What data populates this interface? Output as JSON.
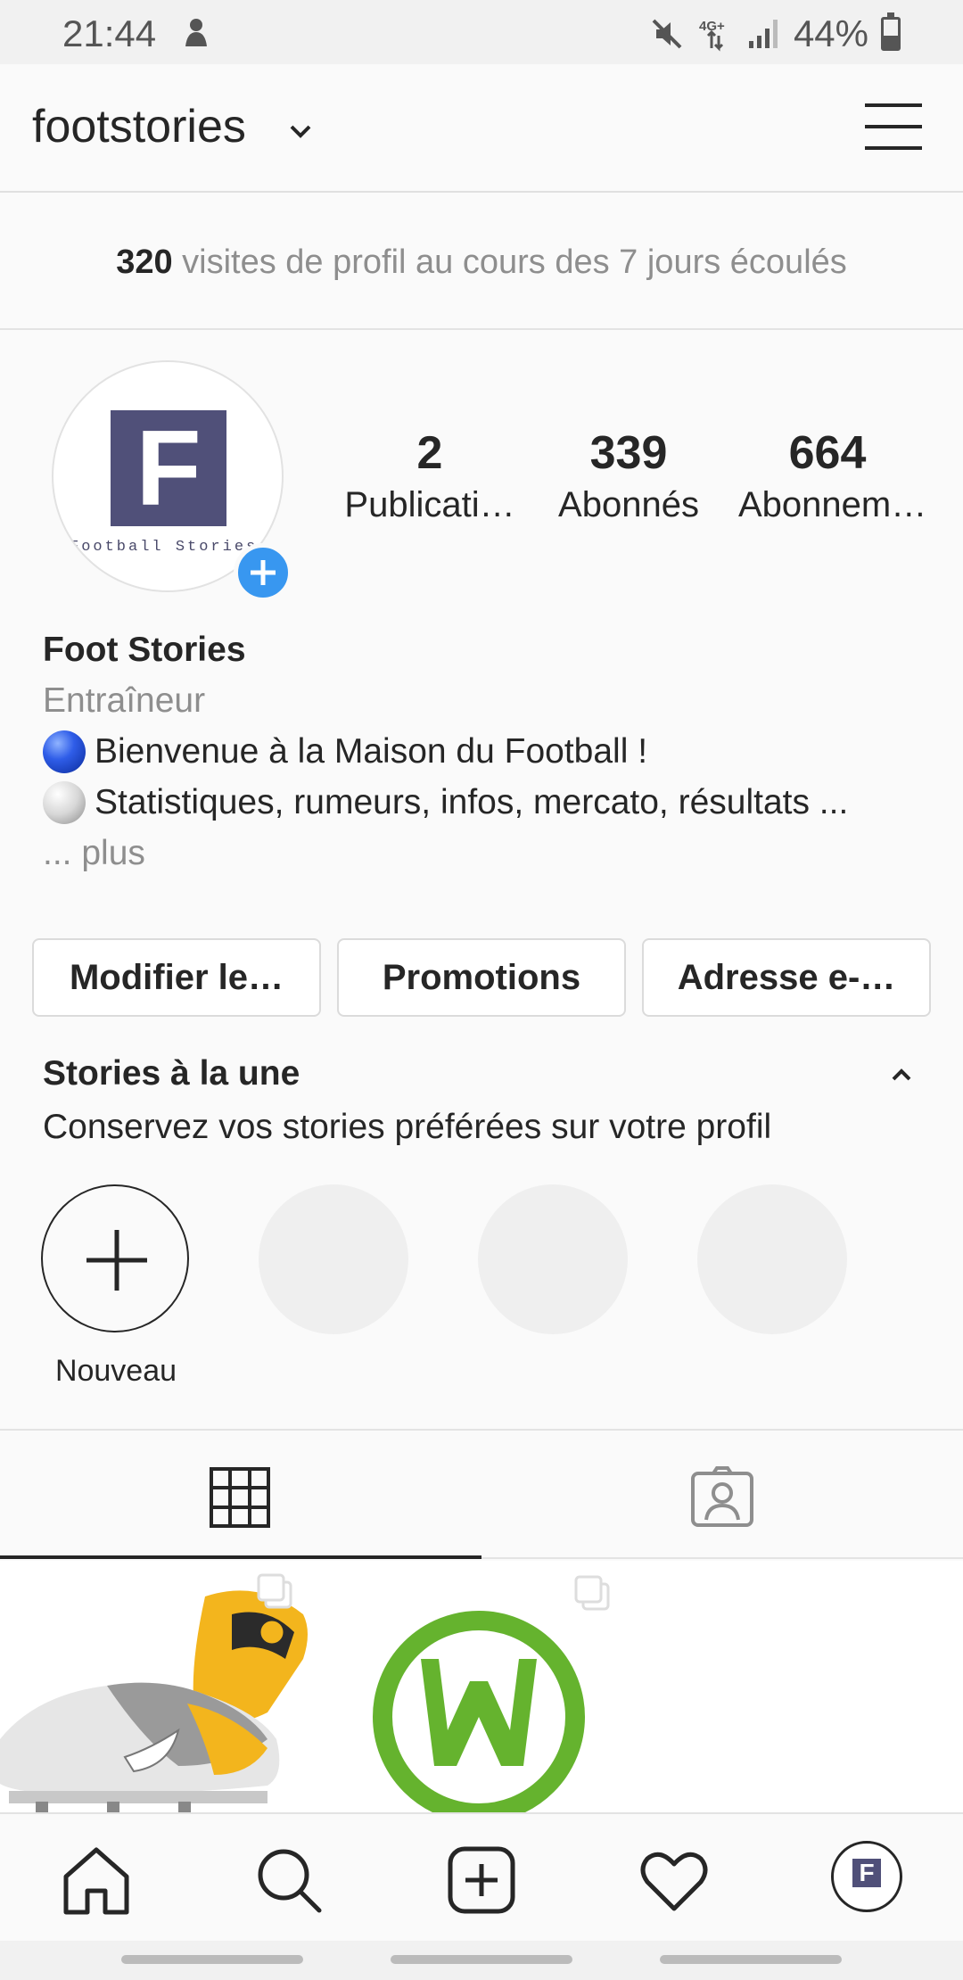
{
  "status_bar": {
    "time": "21:44",
    "battery": "44%",
    "network": "4G+",
    "icons": [
      "notification-icon",
      "mute-icon",
      "signal-icon",
      "battery-icon"
    ]
  },
  "header": {
    "username": "footstories",
    "icons": [
      "chevron-down-icon",
      "menu-icon"
    ]
  },
  "insights": {
    "count": "320",
    "text": " visites de profil au cours des 7 jours écoulés"
  },
  "profile": {
    "avatar_letter": "F",
    "avatar_text": "Football Stories",
    "stats": [
      {
        "value": "2",
        "label": "Publicati…"
      },
      {
        "value": "339",
        "label": "Abonnés"
      },
      {
        "value": "664",
        "label": "Abonnem…"
      }
    ],
    "name": "Foot Stories",
    "category": "Entraîneur",
    "bio_lines": [
      "Bienvenue à la Maison du Football !",
      "Statistiques, rumeurs, infos, mercato, résultats ..."
    ],
    "more": "... plus"
  },
  "buttons": {
    "edit": "Modifier le…",
    "promotions": "Promotions",
    "email": "Adresse e-…"
  },
  "highlights": {
    "title": "Stories à la une",
    "subtitle": "Conservez vos stories préférées sur votre profil",
    "new_label": "Nouveau"
  },
  "tabs": [
    "grid-icon",
    "tagged-icon"
  ],
  "bottom_nav": [
    "home-icon",
    "search-icon",
    "add-post-icon",
    "heart-icon",
    "profile-icon"
  ],
  "colors": {
    "accent": "#3897f0",
    "text": "#262626",
    "muted": "#8e8e8e",
    "avatar": "#505079",
    "wolfsburg_green": "#65b32e",
    "boot_yellow": "#f3b51d"
  }
}
